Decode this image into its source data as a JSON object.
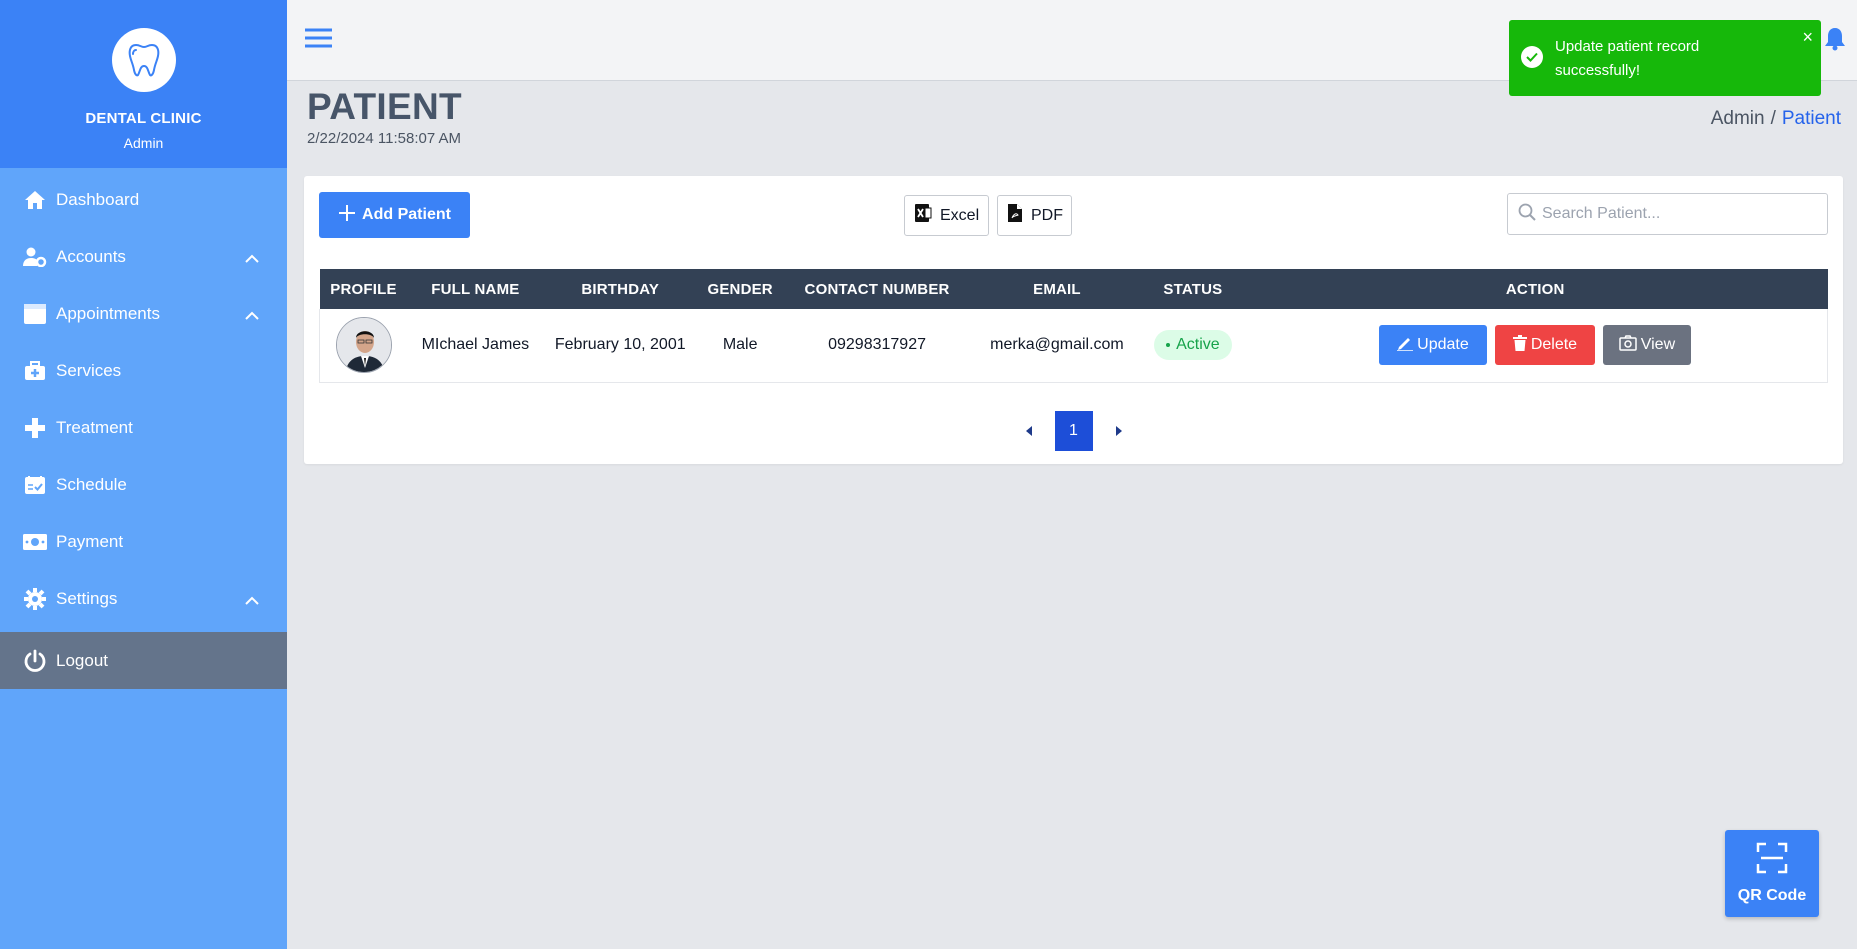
{
  "sidebar": {
    "brand_name": "DENTAL CLINIC",
    "brand_role": "Admin",
    "items": [
      {
        "label": "Dashboard",
        "icon": "home-icon"
      },
      {
        "label": "Accounts",
        "icon": "user-gear-icon"
      },
      {
        "label": "Appointments",
        "icon": "calendar-icon"
      },
      {
        "label": "Services",
        "icon": "medical-kit-icon"
      },
      {
        "label": "Treatment",
        "icon": "plus-cross-icon"
      },
      {
        "label": "Schedule",
        "icon": "calendar-check-icon"
      },
      {
        "label": "Payment",
        "icon": "money-icon"
      },
      {
        "label": "Settings",
        "icon": "gear-icon"
      }
    ],
    "logout_label": "Logout"
  },
  "page": {
    "title": "PATIENT",
    "datetime": "2/22/2024 11:58:07 AM",
    "breadcrumb": {
      "root": "Admin",
      "separator": "/",
      "current": "Patient"
    }
  },
  "toolbar": {
    "add_label": "Add Patient",
    "excel_label": "Excel",
    "pdf_label": "PDF",
    "search_placeholder": "Search Patient..."
  },
  "table": {
    "headers": [
      "PROFILE",
      "FULL NAME",
      "BIRTHDAY",
      "GENDER",
      "CONTACT NUMBER",
      "EMAIL",
      "STATUS",
      "ACTION"
    ],
    "rows": [
      {
        "full_name": "MIchael James",
        "birthday": "February 10, 2001",
        "gender": "Male",
        "contact": "09298317927",
        "email": "merka@gmail.com",
        "status": "Active"
      }
    ],
    "actions": {
      "update": "Update",
      "delete": "Delete",
      "view": "View"
    }
  },
  "pagination": {
    "current_page": "1"
  },
  "toast": {
    "message": "Update patient record successfully!",
    "close": "×"
  },
  "qr_button": {
    "label": "QR Code"
  },
  "colors": {
    "sidebar": "#60a5fa",
    "brand": "#3b82f6",
    "table_header": "#334155",
    "toast": "#16b80a",
    "delete": "#ef4444",
    "view": "#6b7280"
  }
}
